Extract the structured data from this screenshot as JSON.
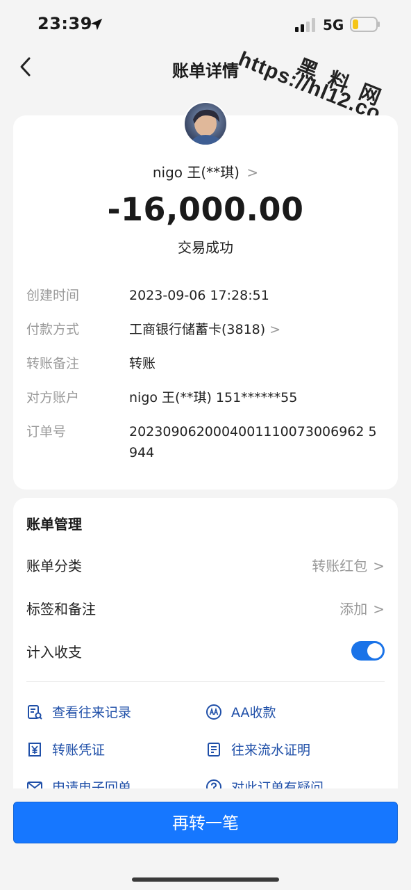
{
  "status_bar": {
    "time": "23:39",
    "network": "5G"
  },
  "watermark": {
    "cn": "黑 料 网",
    "url": "https://hl12.co"
  },
  "nav": {
    "title": "账单详情"
  },
  "transaction": {
    "payee": "nigo 王(**琪)",
    "chevron": ">",
    "amount": "-16,000.00",
    "status": "交易成功",
    "details": [
      {
        "key": "创建时间",
        "value": "2023-09-06 17:28:51"
      },
      {
        "key": "付款方式",
        "value": "工商银行储蓄卡(3818)",
        "chevron": ">"
      },
      {
        "key": "转账备注",
        "value": "转账"
      },
      {
        "key": "对方账户",
        "value": "nigo 王(**琪) 151******55"
      },
      {
        "key": "订单号",
        "value": "2023090620004001110073006962 5944"
      }
    ]
  },
  "management": {
    "title": "账单管理",
    "rows": [
      {
        "label": "账单分类",
        "value": "转账红包",
        "chevron": ">"
      },
      {
        "label": "标签和备注",
        "value": "添加",
        "chevron": ">"
      },
      {
        "label": "计入收支",
        "toggle_on": true
      }
    ],
    "actions": [
      {
        "label": "查看往来记录",
        "icon": "record-search-icon"
      },
      {
        "label": "AA收款",
        "icon": "aa-collect-icon"
      },
      {
        "label": "转账凭证",
        "icon": "yuan-voucher-icon"
      },
      {
        "label": "往来流水证明",
        "icon": "statement-icon"
      },
      {
        "label": "申请电子回单",
        "icon": "mail-icon"
      },
      {
        "label": "对此订单有疑问",
        "icon": "question-icon"
      }
    ]
  },
  "footer": {
    "primary_button": "再转一笔"
  },
  "colors": {
    "accent": "#1677ff",
    "link": "#1f4fa8",
    "toggle": "#1a73e8"
  }
}
